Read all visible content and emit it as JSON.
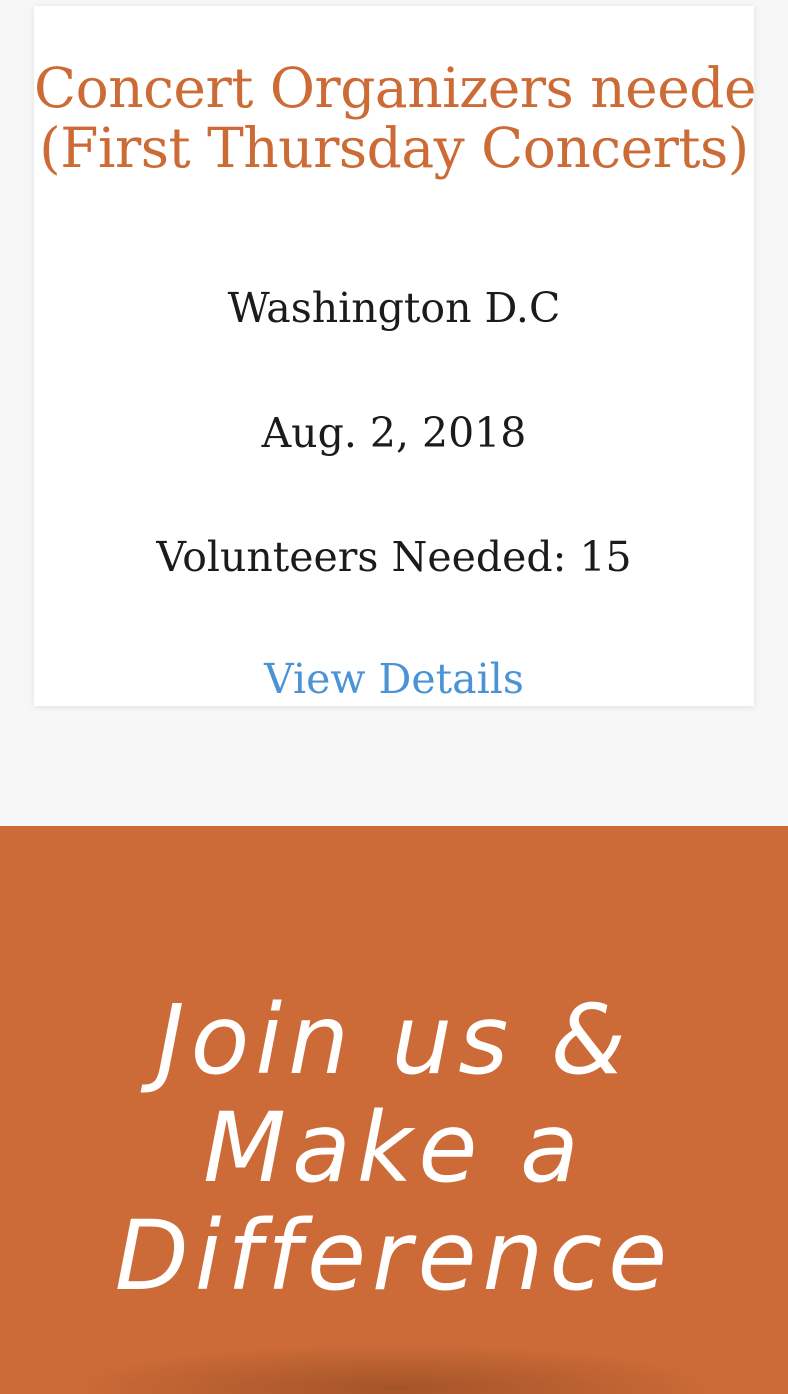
{
  "event": {
    "title_line1": "Concert Organizers needed",
    "title_line2": "(First Thursday Concerts)",
    "location": "Washington D.C",
    "date": "Aug. 2, 2018",
    "volunteers": "Volunteers Needed: 15",
    "details_link": "View Details"
  },
  "cta": {
    "line1": "Join us &",
    "line2": "Make a",
    "line3": "Difference"
  },
  "colors": {
    "accent": "#cc6b35",
    "link": "#4a94d6",
    "banner": "#cc6b37",
    "page_bg": "#f7f7f7"
  }
}
